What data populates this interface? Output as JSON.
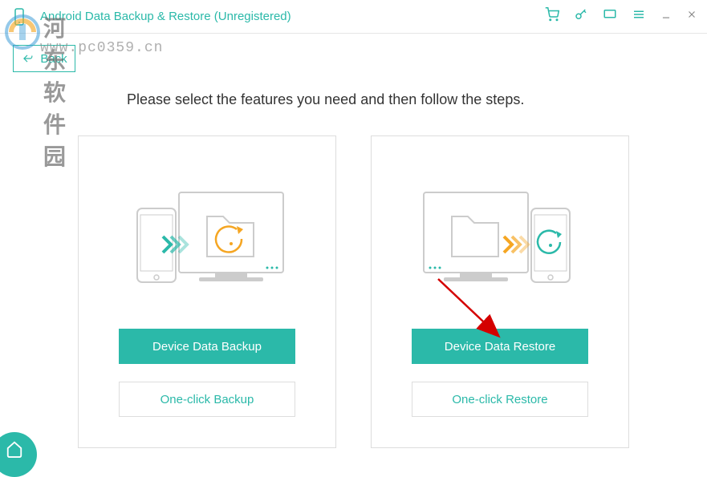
{
  "titlebar": {
    "app_title": "Android Data Backup & Restore (Unregistered)"
  },
  "back_button": {
    "label": "Back"
  },
  "instruction_text": "Please select the features you need and then follow the steps.",
  "cards": {
    "backup": {
      "primary": "Device Data Backup",
      "secondary": "One-click Backup"
    },
    "restore": {
      "primary": "Device Data Restore",
      "secondary": "One-click Restore"
    }
  },
  "watermark": {
    "text_cn": "河东软件园",
    "text_url": "www.pc0359.cn"
  },
  "colors": {
    "accent": "#2bb9a9",
    "arrow": "#d40000"
  }
}
